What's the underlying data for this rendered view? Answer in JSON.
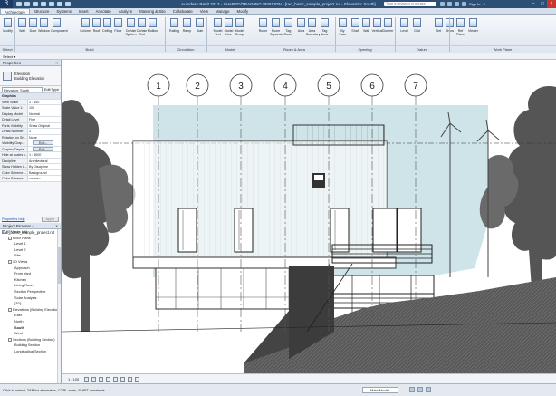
{
  "titlebar": {
    "app_button": "R",
    "title": "Autodesk Revit 2013 - SHARED/TRAINING VERSION - [rac_basic_sample_project.rvt - Elevation: South]",
    "search_placeholder": "Type a keyword or phrase",
    "sign_in": "Sign In",
    "help": "?"
  },
  "tabs": [
    "Architecture",
    "Structure",
    "Systems",
    "Insert",
    "Annotate",
    "Analyze",
    "Massing & Site",
    "Collaborate",
    "View",
    "Manage",
    "Modify"
  ],
  "active_tab": "Architecture",
  "ribbon": {
    "tools": [
      "Modify",
      "Wall",
      "Door",
      "Window",
      "Component",
      "Column",
      "Roof",
      "Ceiling",
      "Floor",
      "Curtain System",
      "Curtain Grid",
      "Mullion",
      "Railing",
      "Ramp",
      "Stair",
      "Model Text",
      "Model Line",
      "Model Group",
      "Room",
      "Room Separator",
      "Tag Room",
      "Area",
      "Area Boundary",
      "Tag Area",
      "By Face",
      "Shaft",
      "Wall",
      "Vertical",
      "Dormer",
      "Level",
      "Grid",
      "Set",
      "Show",
      "Ref Plane",
      "Viewer"
    ],
    "groups": [
      "Select",
      "Build",
      "Circulation",
      "Model",
      "Room & Area",
      "Opening",
      "Datum",
      "Work Plane"
    ]
  },
  "modify_bar": "Select ▾",
  "properties": {
    "title": "Properties",
    "close": "×",
    "family": "Elevation",
    "type": "Building Elevation",
    "selector": "Elevation: South",
    "edit_type": "Edit Type",
    "rows": [
      {
        "k": "Graphics",
        "v": "",
        "section": true
      },
      {
        "k": "View Scale",
        "v": "1 : 100"
      },
      {
        "k": "Scale Value 1:",
        "v": "100"
      },
      {
        "k": "Display Model",
        "v": "Normal"
      },
      {
        "k": "Detail Level",
        "v": "Fine"
      },
      {
        "k": "Parts Visibility",
        "v": "Show Original"
      },
      {
        "k": "Detail Number",
        "v": "1"
      },
      {
        "k": "Rotation on Sh...",
        "v": "None"
      },
      {
        "k": "Visibility/Grap...",
        "v": "Edit..."
      },
      {
        "k": "Graphic Displa...",
        "v": "Edit..."
      },
      {
        "k": "Hide at scales c...",
        "v": "1 : 5000"
      },
      {
        "k": "Discipline",
        "v": "Architectural"
      },
      {
        "k": "Show Hidden L...",
        "v": "By Discipline"
      },
      {
        "k": "Color Scheme ...",
        "v": "Background"
      },
      {
        "k": "Color Scheme",
        "v": "<none>"
      }
    ],
    "help_link": "Properties help",
    "apply": "Apply"
  },
  "browser": {
    "title": "Project Browser - rac_basic_sample_project.rvt",
    "items": [
      {
        "t": "[0] Views (all)",
        "lvl": 0,
        "tg": "-"
      },
      {
        "t": "Floor Plans",
        "lvl": 1,
        "tg": "-"
      },
      {
        "t": "Level 1",
        "lvl": 2
      },
      {
        "t": "Level 2",
        "lvl": 2
      },
      {
        "t": "Site",
        "lvl": 2
      },
      {
        "t": "3D Views",
        "lvl": 1,
        "tg": "-"
      },
      {
        "t": "Approach",
        "lvl": 2
      },
      {
        "t": "From Yard",
        "lvl": 2
      },
      {
        "t": "Kitchen",
        "lvl": 2
      },
      {
        "t": "Living Room",
        "lvl": 2
      },
      {
        "t": "Section Perspective",
        "lvl": 2
      },
      {
        "t": "Solar Analysis",
        "lvl": 2
      },
      {
        "t": "{3D}",
        "lvl": 2
      },
      {
        "t": "Elevations (Building Elevation)",
        "lvl": 1,
        "tg": "-"
      },
      {
        "t": "East",
        "lvl": 2
      },
      {
        "t": "North",
        "lvl": 2
      },
      {
        "t": "South",
        "lvl": 2,
        "bold": true
      },
      {
        "t": "West",
        "lvl": 2
      },
      {
        "t": "Sections (Building Section)",
        "lvl": 1,
        "tg": "-"
      },
      {
        "t": "Building Section",
        "lvl": 2
      },
      {
        "t": "Longitudinal Section",
        "lvl": 2
      }
    ]
  },
  "canvas": {
    "grid_labels": [
      "1",
      "2",
      "3",
      "4",
      "5",
      "6",
      "7"
    ]
  },
  "view_control": {
    "scale": "1 : 100"
  },
  "status": {
    "text": "Click to select, TAB for alternates, CTRL adds, SHIFT unselects.",
    "model": "Main Model",
    "count": ":0"
  }
}
